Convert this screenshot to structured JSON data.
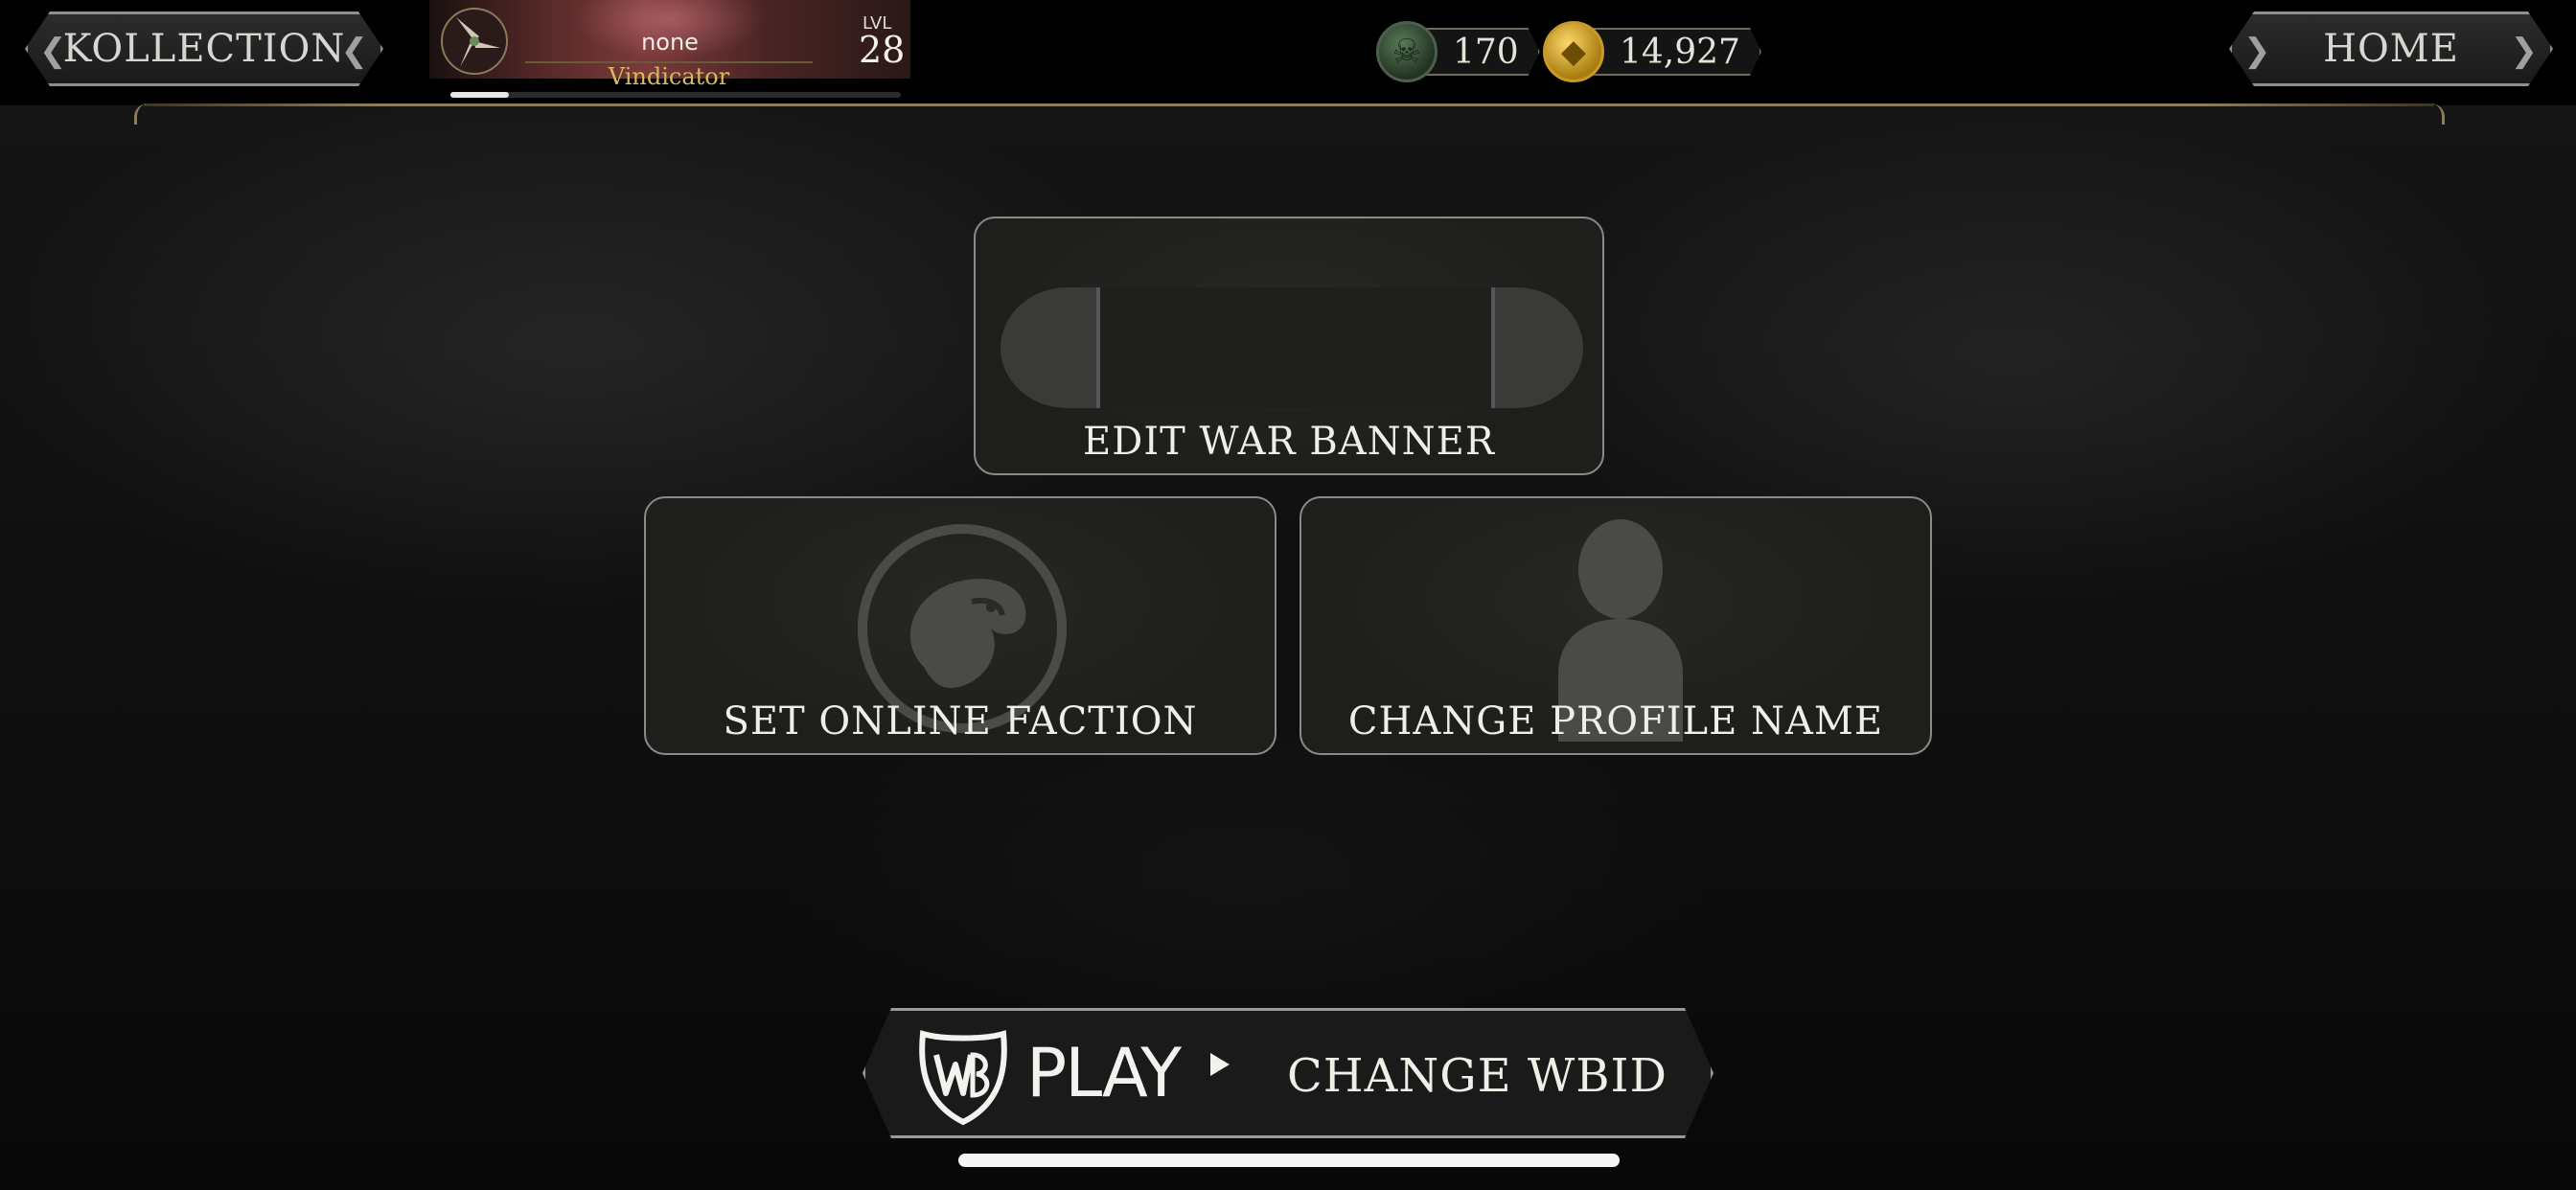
{
  "nav": {
    "back_label": "KOLLECTION",
    "home_label": "HOME"
  },
  "profile": {
    "name": "none",
    "title": "Vindicator",
    "level_label": "LVL",
    "level": "28",
    "xp_progress": 0.13
  },
  "currencies": [
    {
      "icon": "skull-coin-icon",
      "amount": "170",
      "color": "#4d5e4d"
    },
    {
      "icon": "gold-coin-icon",
      "amount": "14,927",
      "color": "#c89a2a"
    }
  ],
  "menu": {
    "edit_war_banner": "EDIT WAR BANNER",
    "set_online_faction": "SET ONLINE FACTION",
    "change_profile_name": "CHANGE PROFILE NAME"
  },
  "wb": {
    "logo_text": "PLAY",
    "label": "CHANGE WBID"
  }
}
